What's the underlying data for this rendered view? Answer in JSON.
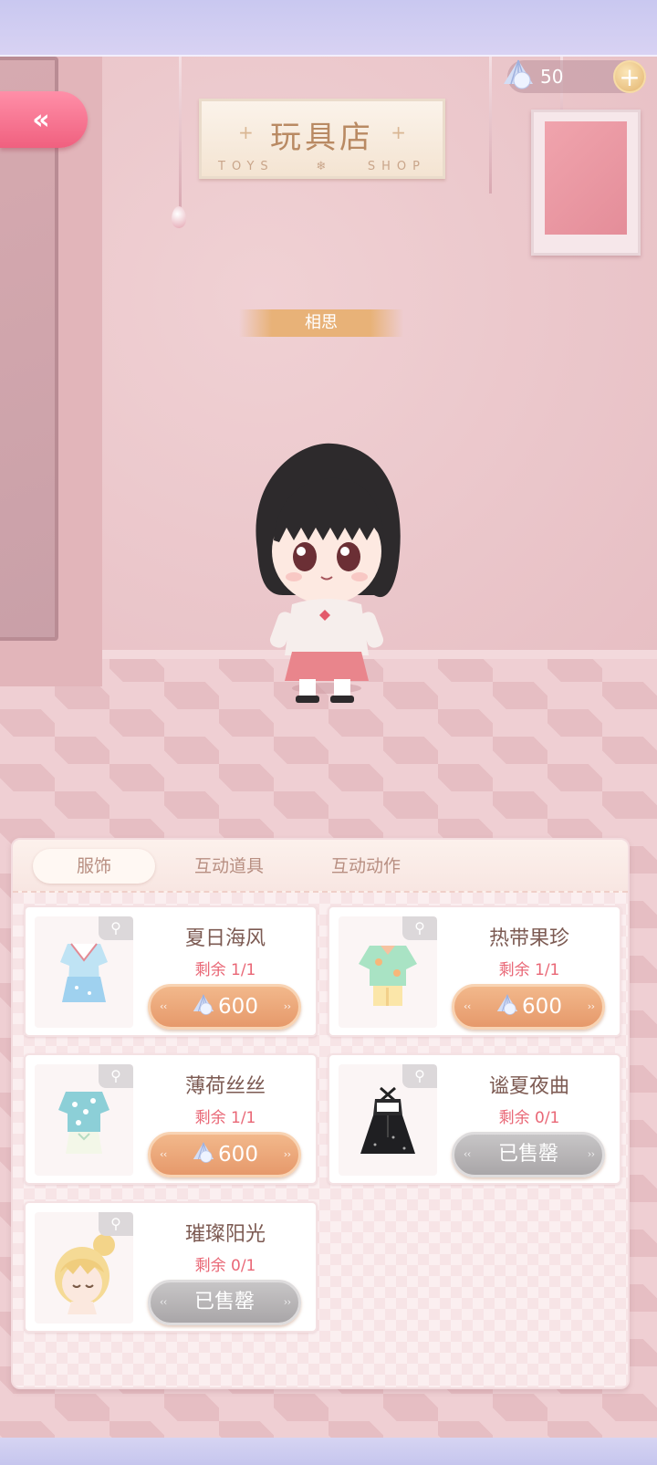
{
  "header": {
    "back_icon": "double-chevron-left-icon",
    "currency": {
      "icon": "pearl-shell-icon",
      "amount": "50",
      "add_icon": "plus-icon"
    }
  },
  "shop_sign": {
    "title": "玩具店",
    "subtitle_left": "TOYS",
    "subtitle_right": "SHOP"
  },
  "character": {
    "name": "相思"
  },
  "panel": {
    "tabs": [
      {
        "label": "服饰",
        "active": true
      },
      {
        "label": "互动道具",
        "active": false
      },
      {
        "label": "互动动作",
        "active": false
      }
    ],
    "items": [
      {
        "name": "夏日海风",
        "stock": "剩余 1/1",
        "price": "600",
        "sold": false,
        "thumb": "sailor-dress"
      },
      {
        "name": "热带果珍",
        "stock": "剩余 1/1",
        "price": "600",
        "sold": false,
        "thumb": "tropical-shirt"
      },
      {
        "name": "薄荷丝丝",
        "stock": "剩余 1/1",
        "price": "600",
        "sold": false,
        "thumb": "mint-outfit"
      },
      {
        "name": "谧夏夜曲",
        "stock": "剩余 0/1",
        "sold_label": "已售罄",
        "sold": true,
        "thumb": "black-dress"
      },
      {
        "name": "璀璨阳光",
        "stock": "剩余 0/1",
        "sold_label": "已售罄",
        "sold": true,
        "thumb": "blonde-bun-hair"
      }
    ]
  },
  "colors": {
    "accent_pink": "#f0607f",
    "price_orange": "#e6996b",
    "sold_grey": "#a9a6a8",
    "stock_red": "#e96776"
  }
}
